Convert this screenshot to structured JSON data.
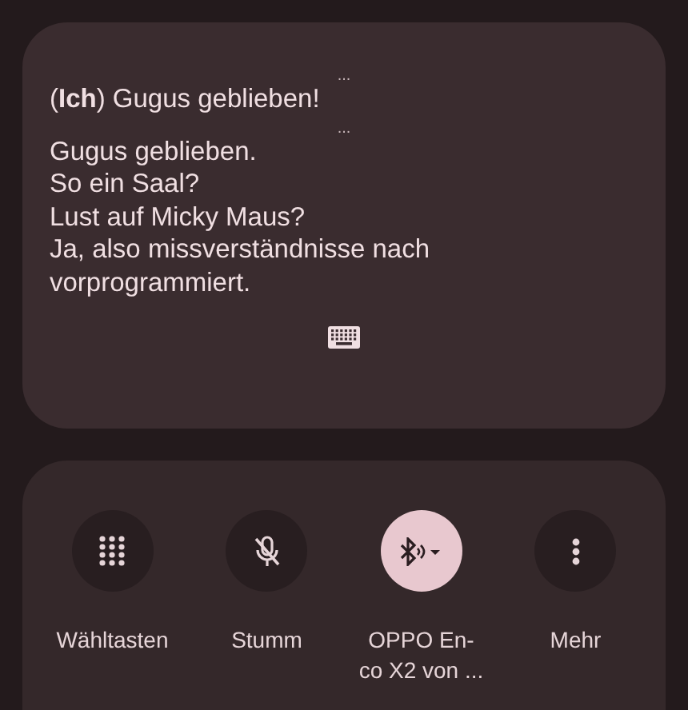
{
  "transcript": [
    {
      "kind": "ellipsis",
      "text": "..."
    },
    {
      "kind": "line",
      "text": "(**Ich**) Gugus geblieben!"
    },
    {
      "kind": "ellipsis",
      "text": "..."
    },
    {
      "kind": "line",
      "text": "Gugus geblieben."
    },
    {
      "kind": "line",
      "text": "So ein Saal?"
    },
    {
      "kind": "line",
      "text": "Lust auf Micky Maus?"
    },
    {
      "kind": "line",
      "text": "Ja, also missverständnisse nach"
    },
    {
      "kind": "line",
      "text": "vorprogrammiert."
    }
  ],
  "call_controls": [
    {
      "kind": "dialpad",
      "label": "Wähltasten",
      "selected": false
    },
    {
      "kind": "mute",
      "label": "Stumm",
      "selected": false
    },
    {
      "kind": "bluetooth",
      "label": "OPPO En-\nco X2 von ...",
      "selected": true
    },
    {
      "kind": "more",
      "label": "Mehr",
      "selected": false
    }
  ]
}
